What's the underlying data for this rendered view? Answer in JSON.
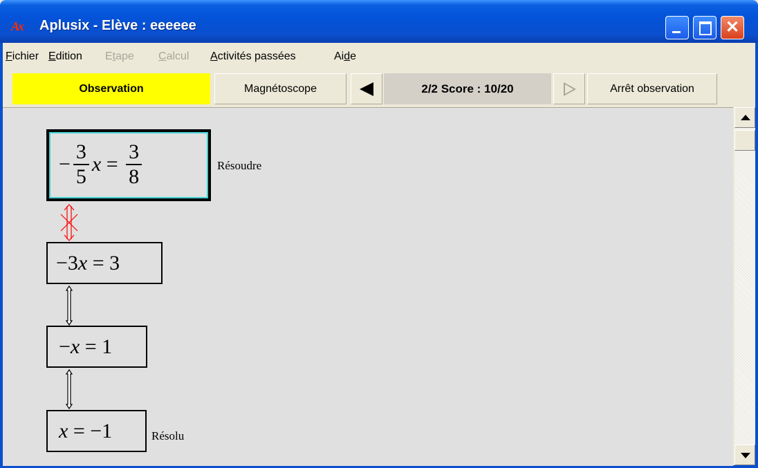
{
  "window": {
    "logo": "Ax",
    "title": "Aplusix - Elève : eeeeee"
  },
  "menu": [
    {
      "label_ul": "F",
      "label_rest": "ichier",
      "enabled": true
    },
    {
      "label_ul": "E",
      "label_rest": "dition",
      "enabled": true
    },
    {
      "label_pre": "E",
      "label_ul": "t",
      "label_rest": "ape",
      "enabled": false
    },
    {
      "label_ul": "C",
      "label_rest": "alcul",
      "enabled": false
    },
    {
      "label_ul": "A",
      "label_rest": "ctivités passées",
      "enabled": true
    },
    {
      "label_pre": "Ai",
      "label_ul": "d",
      "label_rest": "e",
      "enabled": true
    }
  ],
  "toolbar": {
    "mode": "Observation",
    "magneto": "Magnétoscope",
    "score": "2/2  Score : 10/20",
    "stop": "Arrêt observation"
  },
  "steps": [
    {
      "minus": "−",
      "num1": "3",
      "den1": "5",
      "var": "x",
      "eq": "=",
      "num2": "3",
      "den2": "8",
      "label": "Résoudre"
    },
    {
      "expr_minus": "−",
      "expr_coef": "3",
      "expr_var": "x",
      "expr_rest": " = 3"
    },
    {
      "expr_minus": "−",
      "expr_var": "x",
      "expr_rest": " = 1"
    },
    {
      "expr_var": "x",
      "expr_rest": " = −1",
      "label": "Résolu"
    }
  ],
  "colors": {
    "mode_bg": "#ffff00",
    "error_arrow": "#ff0000",
    "active_border": "#40d0d0"
  }
}
